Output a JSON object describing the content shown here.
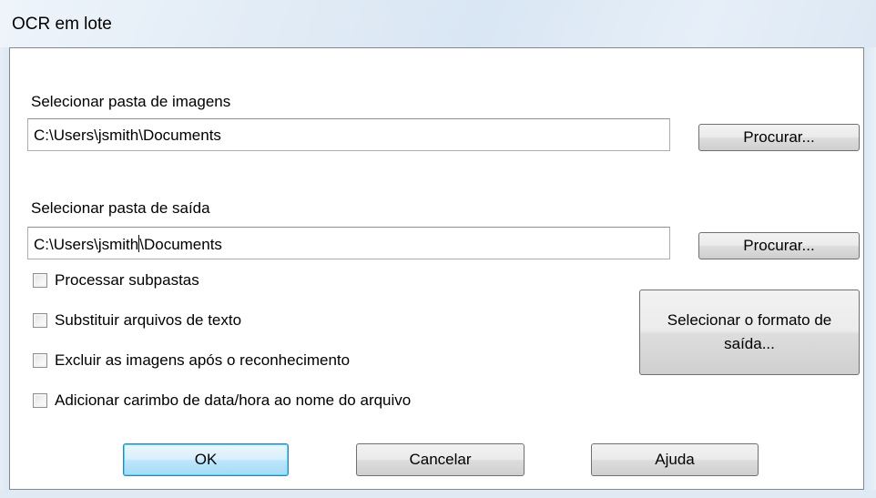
{
  "window": {
    "title": "OCR em lote"
  },
  "images_folder": {
    "label": "Selecionar pasta de imagens",
    "value": "C:\\Users\\jsmith\\Documents",
    "browse_label": "Procurar..."
  },
  "output_folder": {
    "label": "Selecionar pasta de saída",
    "value_before_caret": "C:\\Users\\jsmith",
    "value_after_caret": "\\Documents",
    "browse_label": "Procurar..."
  },
  "options": [
    {
      "label": "Processar subpastas",
      "checked": false
    },
    {
      "label": "Substituir arquivos de texto",
      "checked": false
    },
    {
      "label": "Excluir as imagens após o reconhecimento",
      "checked": false
    },
    {
      "label": "Adicionar carimbo de data/hora ao nome do arquivo",
      "checked": false
    }
  ],
  "format_button": {
    "line1": "Selecionar o formato de",
    "line2": "saída..."
  },
  "footer": {
    "ok_label": "OK",
    "cancel_label": "Cancelar",
    "help_label": "Ajuda"
  }
}
